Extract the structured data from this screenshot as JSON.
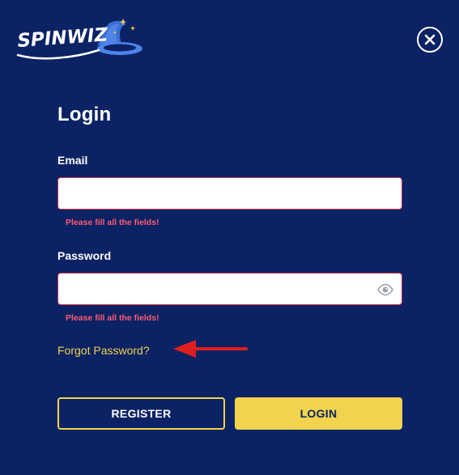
{
  "brand": {
    "logo_text": "SPINWIZ"
  },
  "header": {
    "close_icon": "close-icon"
  },
  "form": {
    "title": "Login",
    "email": {
      "label": "Email",
      "value": "",
      "placeholder": "",
      "error": "Please fill all the fields!"
    },
    "password": {
      "label": "Password",
      "value": "",
      "placeholder": "",
      "error": "Please fill all the fields!",
      "toggle_icon": "eye-icon"
    },
    "forgot_label": "Forgot Password?",
    "register_label": "REGISTER",
    "login_label": "LOGIN"
  },
  "colors": {
    "background": "#0b2265",
    "accent": "#f1d34d",
    "error": "#ff5b6e",
    "field_border": "#d0324a",
    "annotation_arrow": "#e01e1e"
  }
}
